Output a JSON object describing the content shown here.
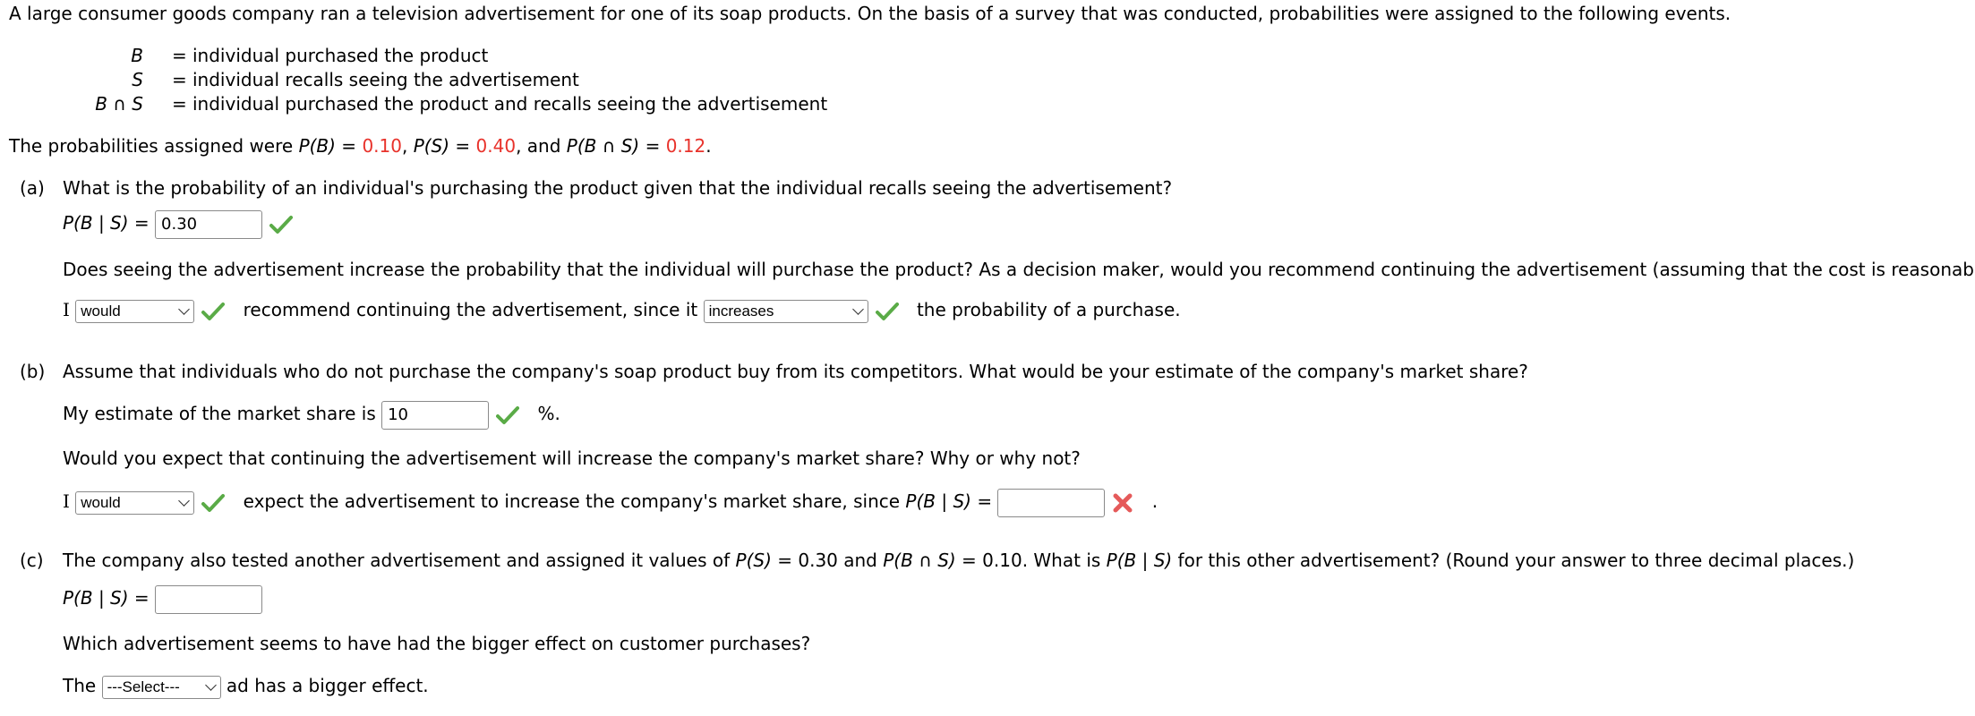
{
  "intro": "A large consumer goods company ran a television advertisement for one of its soap products. On the basis of a survey that was conducted, probabilities were assigned to the following events.",
  "definitions": [
    {
      "symbol": "B",
      "text": "individual purchased the product"
    },
    {
      "symbol": "S",
      "text": "individual recalls seeing the advertisement"
    },
    {
      "symbol": "B ∩ S",
      "text": "individual purchased the product and recalls seeing the advertisement"
    }
  ],
  "probabilities": {
    "prefix": "The probabilities assigned were ",
    "pb_label": "P(B)",
    "pb_value": "0.10",
    "ps_label": "P(S)",
    "ps_value": "0.40",
    "pbs_label": "P(B ∩ S)",
    "pbs_value": "0.12"
  },
  "part_a": {
    "label": "(a)",
    "question": "What is the probability of an individual's purchasing the product given that the individual recalls seeing the advertisement?",
    "answer_label": "P(B | S) =",
    "answer_value": "0.30",
    "answer_status": "correct",
    "followup": "Does seeing the advertisement increase the probability that the individual will purchase the product? As a decision maker, would you recommend continuing the advertisement (assuming that the cost is reasonable)?",
    "sentence_start": "I",
    "select1_value": "would",
    "select1_status": "correct",
    "sentence_mid": "recommend continuing the advertisement, since it",
    "select2_value": "increases",
    "select2_status": "correct",
    "sentence_end": "the probability of a purchase."
  },
  "part_b": {
    "label": "(b)",
    "question": "Assume that individuals who do not purchase the company's soap product buy from its competitors. What would be your estimate of the company's market share?",
    "estimate_prefix": "My estimate of the market share is",
    "estimate_value": "10",
    "estimate_status": "correct",
    "estimate_suffix": "%.",
    "followup": "Would you expect that continuing the advertisement will increase the company's market share? Why or why not?",
    "sentence_start": "I",
    "select_value": "would",
    "select_status": "correct",
    "sentence_mid": "expect the advertisement to increase the company's market share, since",
    "answer_label": "P(B | S) =",
    "answer_value": "",
    "answer_status": "incorrect",
    "sentence_end": "."
  },
  "part_c": {
    "label": "(c)",
    "question_pre": "The company also tested another advertisement and assigned it values of ",
    "ps_label": "P(S)",
    "ps_value": "= 0.30 and ",
    "pbs_label": "P(B ∩ S)",
    "pbs_value": "= 0.10. What is ",
    "pbgs_label": "P(B | S)",
    "question_post": " for this other advertisement? (Round your answer to three decimal places.)",
    "answer_label": "P(B | S) =",
    "answer_value": "",
    "followup": "Which advertisement seems to have had the bigger effect on customer purchases?",
    "sentence_start": "The",
    "select_value": "---Select---",
    "sentence_end": "ad has a bigger effect."
  },
  "colors": {
    "highlight": "#e8322b",
    "check": "#5aab47",
    "cross": "#e55a5a"
  },
  "icons": {
    "correct": "checkmark-icon",
    "incorrect": "x-mark-icon"
  }
}
